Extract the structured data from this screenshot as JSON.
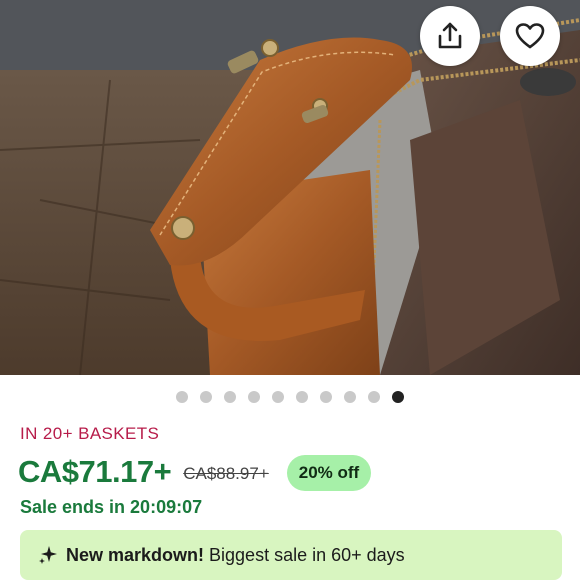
{
  "hero": {
    "image_alt": "leather and canvas toiletry bag",
    "share_icon": "share-icon",
    "favorite_icon": "heart-icon"
  },
  "carousel": {
    "count": 10,
    "active_index": 9
  },
  "listing": {
    "baskets_text": "IN 20+ BASKETS",
    "price": "CA$71.17+",
    "original_price": "CA$88.97+",
    "discount_badge": "20% off",
    "sale_ends_label": "Sale ends in",
    "sale_ends_timer": "20:09:07"
  },
  "markdown_banner": {
    "icon": "sparkle-icon",
    "title": "New markdown!",
    "text": "Biggest sale in 60+ days"
  },
  "colors": {
    "price_green": "#1a7a3c",
    "baskets_red": "#b71c4a",
    "discount_bg": "#a6f0a8",
    "banner_bg": "#d8f5c0"
  }
}
